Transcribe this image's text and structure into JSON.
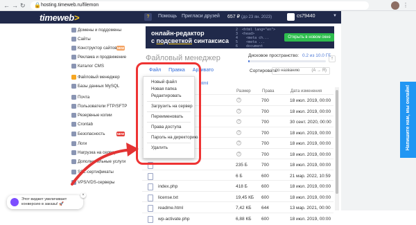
{
  "browser": {
    "url": "hosting.timeweb.ru/filemon"
  },
  "header": {
    "logo_main": "timeweb",
    "logo_mark": ">",
    "help": "Помощь",
    "invite": "Пригласи друзей",
    "balance": "657 ₽",
    "balance_sub": "(до 23 ян. 2023)",
    "username": "cs79440"
  },
  "sidebar": {
    "items": [
      {
        "label": "Домены и поддомены"
      },
      {
        "label": "Сайты"
      },
      {
        "label": "Конструктор сайтов"
      },
      {
        "label": "Реклама и продвижение"
      },
      {
        "label": "Каталог CMS"
      },
      {
        "label": "Файловый менеджер"
      },
      {
        "label": "Базы данных MySQL"
      },
      {
        "label": "Почта"
      },
      {
        "label": "Пользователи FTP/SFTP"
      },
      {
        "label": "Резервные копии"
      },
      {
        "label": "Crontab"
      },
      {
        "label": "Безопасность"
      },
      {
        "label": "Логи"
      },
      {
        "label": "Нагрузка на сервер"
      },
      {
        "label": "Дополнительные услуги"
      },
      {
        "label": "SSL-сертификаты"
      },
      {
        "label": "VPS/VDS-серверы"
      }
    ],
    "badges": [
      {
        "text": "NEW",
        "color": "#f4a261"
      },
      {
        "text": "NEW",
        "color": "#e53935"
      }
    ]
  },
  "promo": {
    "line1": "онлайн-редактор",
    "line2_prefix": "с ",
    "line2_underlined": "подсветкой",
    "line2_suffix": " синтаксиса",
    "code": "2  <html lang=\"en\">\n3  <head>\n4    <meta ch...\n5    <meta ...\n6    document",
    "button": "Открыть в новом окне"
  },
  "page": {
    "title": "Файловый менеджер"
  },
  "disk": {
    "label": "Дисковое пространство:",
    "value": "0.2 из 10.0 ГБ",
    "fraction": 0.02
  },
  "toolbar": {
    "file": "Файл",
    "edit": "Правка",
    "archive": "Архивато"
  },
  "sort": {
    "label": "Сортировать:",
    "value": "по названию",
    "dir": "(А → Я)"
  },
  "path": "html",
  "table": {
    "headers": [
      "Размер",
      "Права",
      "Дата изменения"
    ],
    "rows": [
      {
        "name": "",
        "size": "?",
        "perm": "700",
        "date": "18 июл. 2019, 00:00"
      },
      {
        "name": "",
        "size": "?",
        "perm": "700",
        "date": "18 июл. 2019, 00:00"
      },
      {
        "name": "",
        "size": "?",
        "perm": "700",
        "date": "30 сент. 2020, 00:00"
      },
      {
        "name": "",
        "size": "?",
        "perm": "700",
        "date": "18 июл. 2019, 00:00"
      },
      {
        "name": "",
        "size": "?",
        "perm": "700",
        "date": "18 июл. 2019, 00:00"
      },
      {
        "name": "",
        "size": "?",
        "perm": "700",
        "date": "18 июл. 2019, 00:00"
      },
      {
        "name": "",
        "size": "235 Б",
        "perm": "700",
        "date": "18 июл. 2019, 00:00"
      },
      {
        "name": "",
        "size": "6 Б",
        "perm": "600",
        "date": "21 мар. 2022, 10:59"
      },
      {
        "name": "index.php",
        "size": "418 Б",
        "perm": "600",
        "date": "18 июл. 2019, 00:00"
      },
      {
        "name": "license.txt",
        "size": "19,45 КБ",
        "perm": "600",
        "date": "18 июл. 2019, 00:00"
      },
      {
        "name": "readme.html",
        "size": "7,42 КБ",
        "perm": "644",
        "date": "13 мар. 2021, 00:00"
      },
      {
        "name": "wp-activate.php",
        "size": "6,88 КБ",
        "perm": "600",
        "date": "18 июл. 2019, 00:00"
      }
    ]
  },
  "file_menu": {
    "items": [
      "Новый файл",
      "Новая папка",
      "Редактировать",
      "Загрузить на сервер",
      "Переименовать",
      "Права доступа",
      "Пароль на директорию",
      "Удалить"
    ]
  },
  "feedback": {
    "label": "Напишите нам, мы онлайн!"
  },
  "chat": {
    "line1": "Этот виджет увеличивает",
    "line2": "конверсию в заказы! 🚀"
  },
  "colors": {
    "header_bg": "#20294a",
    "accent": "#ffcd1e",
    "link": "#2f6ad9",
    "highlight": "#e33333",
    "promo_button": "#2ebd4e"
  }
}
